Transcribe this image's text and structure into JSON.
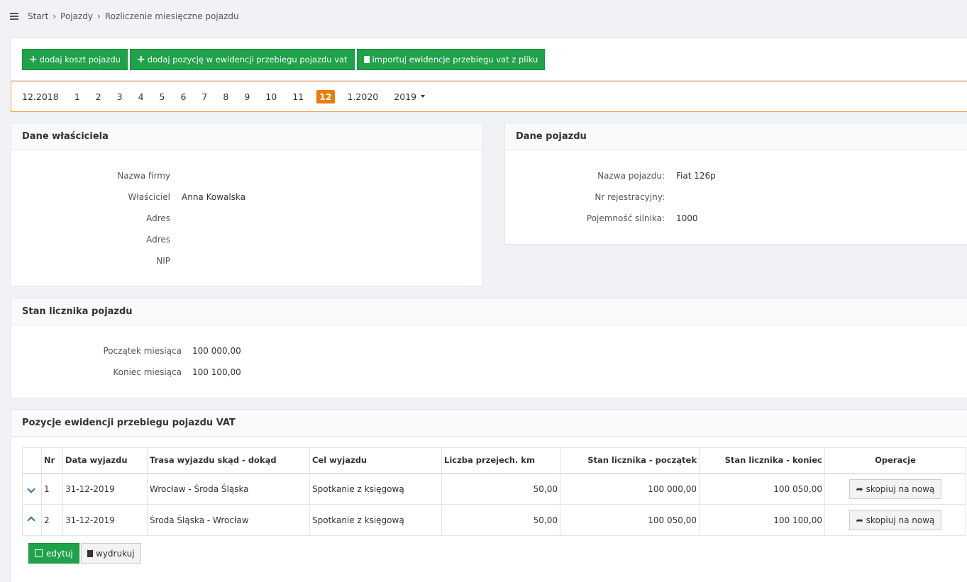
{
  "breadcrumb": {
    "items": [
      "Start",
      "Pojazdy",
      "Rozliczenie miesięczne pojazdu"
    ]
  },
  "toolbar": {
    "add_cost_label": "dodaj koszt pojazdu",
    "add_position_label": "dodaj pozycję w ewidencji przebiegu pojazdu vat",
    "import_label": "importuj ewidencje przebiegu vat z pliku"
  },
  "pager": {
    "prev_label": "12.2018",
    "months": [
      "1",
      "2",
      "3",
      "4",
      "5",
      "6",
      "7",
      "8",
      "9",
      "10",
      "11",
      "12"
    ],
    "active_month": "12",
    "next_label": "1.2020",
    "year_label": "2019"
  },
  "owner": {
    "title": "Dane właściciela",
    "fields": [
      {
        "label": "Nazwa firmy",
        "value": ""
      },
      {
        "label": "Właściciel",
        "value": "Anna Kowalska"
      },
      {
        "label": "Adres",
        "value": ""
      },
      {
        "label": "Adres",
        "value": ""
      },
      {
        "label": "NIP",
        "value": ""
      }
    ]
  },
  "vehicle": {
    "title": "Dane pojazdu",
    "fields": [
      {
        "label": "Nazwa pojazdu:",
        "value": "Fiat 126p"
      },
      {
        "label": "Nr rejestracyjny:",
        "value": ""
      },
      {
        "label": "Pojemność silnika:",
        "value": "1000"
      }
    ]
  },
  "odometer": {
    "title": "Stan licznika pojazdu",
    "fields": [
      {
        "label": "Początek miesiąca",
        "value": "100 000,00"
      },
      {
        "label": "Koniec miesiąca",
        "value": "100 100,00"
      }
    ]
  },
  "trips": {
    "title": "Pozycje ewidencji przebiegu pojazdu VAT",
    "columns": [
      "Nr",
      "Data wyjazdu",
      "Trasa wyjazdu skąd - dokąd",
      "Cel wyjazdu",
      "Liczba przejech. km",
      "Stan licznika - początek",
      "Stan licznika - koniec",
      "Operacje"
    ],
    "rows": [
      {
        "nr": "1",
        "date": "31-12-2019",
        "route": "Wrocław - Środa Śląska",
        "purpose": "Spotkanie z księgową",
        "km": "50,00",
        "start": "100 000,00",
        "end": "100 050,00",
        "copy_label": "skopiuj na nową"
      },
      {
        "nr": "2",
        "date": "31-12-2019",
        "route": "Środa Śląska - Wrocław",
        "purpose": "Spotkanie z księgową",
        "km": "50,00",
        "start": "100 050,00",
        "end": "100 100,00",
        "copy_label": "skopiuj na nową"
      }
    ],
    "edit_label": "edytuj",
    "print_label": "wydrukuj"
  }
}
